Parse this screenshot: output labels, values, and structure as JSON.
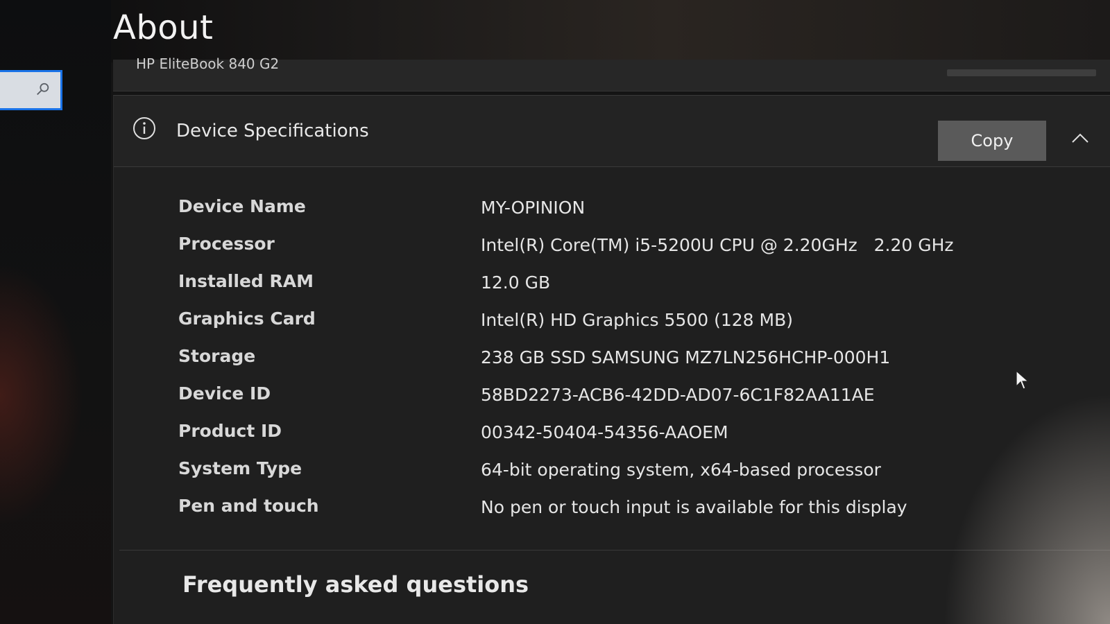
{
  "page": {
    "title": "About",
    "device_model": "HP EliteBook 840 G2"
  },
  "search": {
    "icon": "search-icon"
  },
  "device_specs": {
    "title": "Device Specifications",
    "copy_label": "Copy",
    "rows": [
      {
        "label": "Device Name",
        "value": "MY-OPINION"
      },
      {
        "label": "Processor",
        "value": "Intel(R) Core(TM) i5-5200U CPU @ 2.20GHz   2.20 GHz"
      },
      {
        "label": "Installed RAM",
        "value": "12.0 GB"
      },
      {
        "label": "Graphics Card",
        "value": "Intel(R) HD Graphics 5500 (128 MB)"
      },
      {
        "label": "Storage",
        "value": "238 GB SSD SAMSUNG MZ7LN256HCHP-000H1"
      },
      {
        "label": "Device ID",
        "value": "58BD2273-ACB6-42DD-AD07-6C1F82AA11AE"
      },
      {
        "label": "Product ID",
        "value": "00342-50404-54356-AAOEM"
      },
      {
        "label": "System Type",
        "value": "64-bit operating system, x64-based processor"
      },
      {
        "label": "Pen and touch",
        "value": "No pen or touch input is available for this display"
      }
    ]
  },
  "faq": {
    "heading": "Frequently asked questions"
  },
  "colors": {
    "accent": "#1a73e8",
    "panel": "#1f1f1f",
    "button": "#5a5a5a"
  }
}
